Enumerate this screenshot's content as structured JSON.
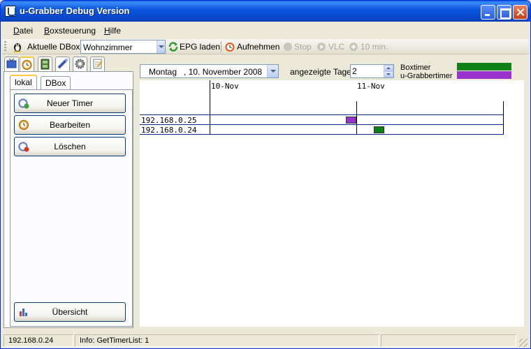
{
  "window": {
    "title": "u-Grabber Debug Version"
  },
  "menu": {
    "items": [
      {
        "label": "Datei",
        "accel": "D",
        "rest": "atei"
      },
      {
        "label": "Boxsteuerung",
        "accel": "B",
        "rest": "oxsteuerung"
      },
      {
        "label": "Hilfe",
        "accel": "H",
        "rest": "ilfe"
      }
    ]
  },
  "toolbar": {
    "dbox_label": "Aktuelle DBox:",
    "dbox_value": "Wohnzimmer",
    "epg_label": "EPG laden",
    "record_label": "Aufnehmen",
    "stop_label": "Stop",
    "vlc_label": "VLC",
    "ten_min_label": "10 min."
  },
  "left_panel": {
    "subtabs": [
      "lokal",
      "DBox"
    ],
    "buttons": {
      "new_timer": "Neuer Timer",
      "edit": "Bearbeiten",
      "delete": "Löschen",
      "overview": "Übersicht"
    }
  },
  "schedule": {
    "date_value": "Montag   , 10. November 2008",
    "days_label": "angezeigte Tage:",
    "days_value": "2",
    "legend": [
      {
        "label": "Boxtimer",
        "color": "#108018"
      },
      {
        "label": "u-Grabbertimer",
        "color": "#9933cc"
      }
    ],
    "day_headers": [
      "10-Nov",
      "11-Nov"
    ],
    "rows": [
      "192.168.0.25",
      "192.168.0.24"
    ]
  },
  "status": {
    "ip": "192.168.0.24",
    "info": "Info: GetTimerList: 1"
  }
}
